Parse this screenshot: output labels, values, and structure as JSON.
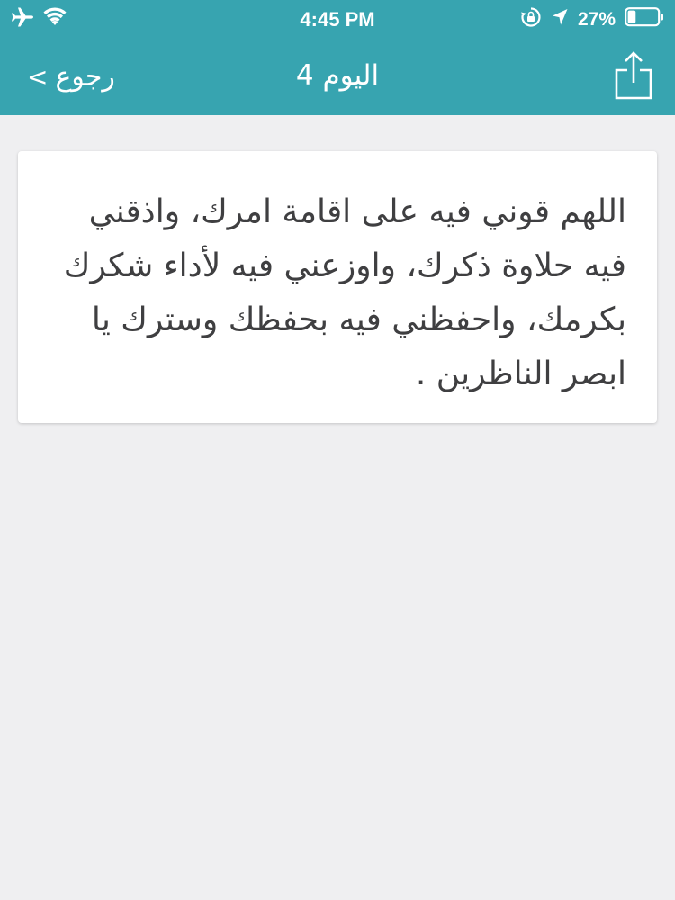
{
  "status_bar": {
    "time": "4:45 PM",
    "battery_percent": "27%",
    "icons": [
      "airplane-icon",
      "wifi-icon",
      "rotation-lock-icon",
      "location-arrow-icon",
      "battery-icon"
    ],
    "battery_level": 0.27
  },
  "nav": {
    "back_label": "رجوع",
    "back_chevron": "<",
    "title": "اليوم 4",
    "share_icon": "share-icon"
  },
  "content": {
    "prayer_text": "اللهم قوني فيه على اقامة امرك، واذقني فيه حلاوة ذكرك، واوزعني فيه لأداء شكرك بكرمك، واحفظني فيه بحفظك وسترك يا ابصر الناظرين ."
  },
  "colors": {
    "header": "#37a4b0",
    "background": "#efeff1",
    "card": "#ffffff",
    "text": "#3f3f41"
  }
}
